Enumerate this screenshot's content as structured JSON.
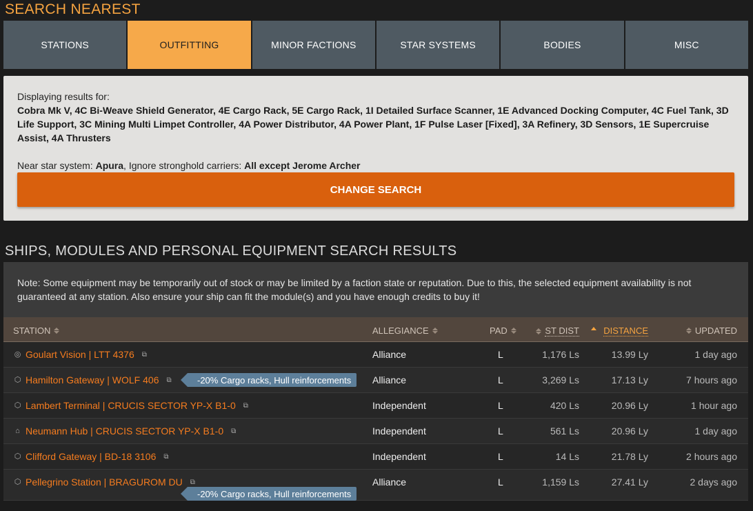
{
  "header": {
    "title": "SEARCH NEAREST"
  },
  "tabs": [
    {
      "label": "STATIONS"
    },
    {
      "label": "OUTFITTING"
    },
    {
      "label": "MINOR FACTIONS"
    },
    {
      "label": "STAR SYSTEMS"
    },
    {
      "label": "BODIES"
    },
    {
      "label": "MISC"
    }
  ],
  "active_tab": "OUTFITTING",
  "summary": {
    "displaying_label": "Displaying results for:",
    "modules": "Cobra Mk V, 4C Bi-Weave Shield Generator, 4E Cargo Rack, 5E Cargo Rack, 1I Detailed Surface Scanner, 1E Advanced Docking Computer, 4C Fuel Tank, 3D Life Support, 3C Mining Multi Limpet Controller, 4A Power Distributor, 4A Power Plant, 1F Pulse Laser [Fixed], 3A Refinery, 3D Sensors, 1E Supercruise Assist, 4A Thrusters",
    "near_label": "Near star system: ",
    "near_value": "Apura",
    "ignore_label": ", Ignore stronghold carriers: ",
    "ignore_value": "All except Jerome Archer",
    "change_button": "CHANGE SEARCH"
  },
  "results": {
    "title": "SHIPS, MODULES AND PERSONAL EQUIPMENT SEARCH RESULTS",
    "note": "Note: Some equipment may be temporarily out of stock or may be limited by a faction state or reputation. Due to this, the selected equipment availability is not guaranteed at any station. Also ensure your ship can fit the module(s) and you have enough credits to buy it!",
    "columns": {
      "station": "STATION",
      "allegiance": "ALLEGIANCE",
      "pad": "PAD",
      "st_dist": "ST DIST",
      "distance": "DISTANCE",
      "updated": "UPDATED"
    },
    "rows": [
      {
        "station": "Goulart Vision | LTT 4376",
        "icon": "outpost-icon",
        "badge": "",
        "allegiance": "Alliance",
        "pad": "L",
        "st_dist": "1,176 Ls",
        "distance": "13.99 Ly",
        "updated": "1 day ago"
      },
      {
        "station": "Hamilton Gateway | WOLF 406",
        "icon": "coriolis-icon",
        "badge": "-20% Cargo racks, Hull reinforcements",
        "allegiance": "Alliance",
        "pad": "L",
        "st_dist": "3,269 Ls",
        "distance": "17.13 Ly",
        "updated": "7 hours ago"
      },
      {
        "station": "Lambert Terminal | CRUCIS SECTOR YP-X B1-0",
        "icon": "coriolis-icon",
        "badge": "",
        "allegiance": "Independent",
        "pad": "L",
        "st_dist": "420 Ls",
        "distance": "20.96 Ly",
        "updated": "1 hour ago"
      },
      {
        "station": "Neumann Hub | CRUCIS SECTOR YP-X B1-0",
        "icon": "settlement-icon",
        "badge": "",
        "allegiance": "Independent",
        "pad": "L",
        "st_dist": "561 Ls",
        "distance": "20.96 Ly",
        "updated": "1 day ago"
      },
      {
        "station": "Clifford Gateway | BD-18 3106",
        "icon": "coriolis-icon",
        "badge": "",
        "allegiance": "Independent",
        "pad": "L",
        "st_dist": "14 Ls",
        "distance": "21.78 Ly",
        "updated": "2 hours ago"
      },
      {
        "station": "Pellegrino Station | BRAGUROM DU",
        "icon": "coriolis-icon",
        "badge": "-20% Cargo racks, Hull reinforcements",
        "allegiance": "Alliance",
        "pad": "L",
        "st_dist": "1,159 Ls",
        "distance": "27.41 Ly",
        "updated": "2 days ago"
      }
    ]
  },
  "colors": {
    "accent": "#f5a340",
    "button": "#d9600d",
    "tab": "#4f5a62",
    "badge": "#5d7f9a",
    "link": "#f57c1f"
  }
}
